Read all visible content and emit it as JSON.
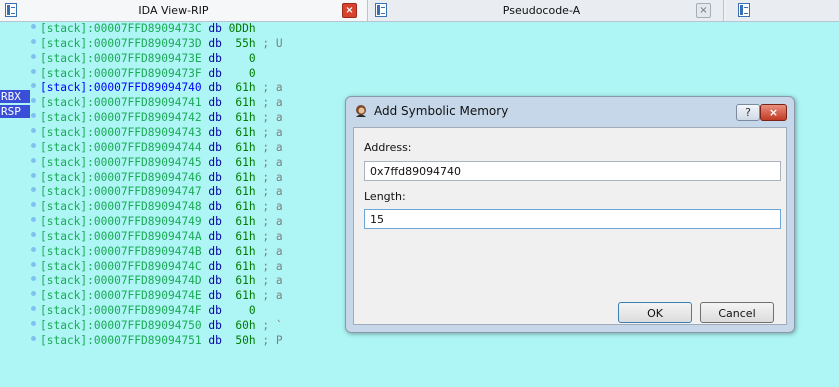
{
  "tabs": {
    "ida_view": {
      "title": "IDA View-RIP",
      "close": "×"
    },
    "pseudocode": {
      "title": "Pseudocode-A",
      "close": "×"
    }
  },
  "registers": {
    "rbx": "RBX",
    "rsp": "RSP"
  },
  "listing": [
    {
      "addr": "[stack]:00007FFD8909473C",
      "mn": "db",
      "val": "0DDh",
      "cmt": ""
    },
    {
      "addr": "[stack]:00007FFD8909473D",
      "mn": "db",
      "val": "55h",
      "cmt": "; U"
    },
    {
      "addr": "[stack]:00007FFD8909473E",
      "mn": "db",
      "val": "0",
      "cmt": ""
    },
    {
      "addr": "[stack]:00007FFD8909473F",
      "mn": "db",
      "val": "0",
      "cmt": ""
    },
    {
      "addr": "[stack]:00007FFD89094740",
      "mn": "db",
      "val": "61h",
      "cmt": "; a"
    },
    {
      "addr": "[stack]:00007FFD89094741",
      "mn": "db",
      "val": "61h",
      "cmt": "; a"
    },
    {
      "addr": "[stack]:00007FFD89094742",
      "mn": "db",
      "val": "61h",
      "cmt": "; a"
    },
    {
      "addr": "[stack]:00007FFD89094743",
      "mn": "db",
      "val": "61h",
      "cmt": "; a"
    },
    {
      "addr": "[stack]:00007FFD89094744",
      "mn": "db",
      "val": "61h",
      "cmt": "; a"
    },
    {
      "addr": "[stack]:00007FFD89094745",
      "mn": "db",
      "val": "61h",
      "cmt": "; a"
    },
    {
      "addr": "[stack]:00007FFD89094746",
      "mn": "db",
      "val": "61h",
      "cmt": "; a"
    },
    {
      "addr": "[stack]:00007FFD89094747",
      "mn": "db",
      "val": "61h",
      "cmt": "; a"
    },
    {
      "addr": "[stack]:00007FFD89094748",
      "mn": "db",
      "val": "61h",
      "cmt": "; a"
    },
    {
      "addr": "[stack]:00007FFD89094749",
      "mn": "db",
      "val": "61h",
      "cmt": "; a"
    },
    {
      "addr": "[stack]:00007FFD8909474A",
      "mn": "db",
      "val": "61h",
      "cmt": "; a"
    },
    {
      "addr": "[stack]:00007FFD8909474B",
      "mn": "db",
      "val": "61h",
      "cmt": "; a"
    },
    {
      "addr": "[stack]:00007FFD8909474C",
      "mn": "db",
      "val": "61h",
      "cmt": "; a"
    },
    {
      "addr": "[stack]:00007FFD8909474D",
      "mn": "db",
      "val": "61h",
      "cmt": "; a"
    },
    {
      "addr": "[stack]:00007FFD8909474E",
      "mn": "db",
      "val": "61h",
      "cmt": "; a"
    },
    {
      "addr": "[stack]:00007FFD8909474F",
      "mn": "db",
      "val": "0",
      "cmt": ""
    },
    {
      "addr": "[stack]:00007FFD89094750",
      "mn": "db",
      "val": "60h",
      "cmt": "; `"
    },
    {
      "addr": "[stack]:00007FFD89094751",
      "mn": "db",
      "val": "50h",
      "cmt": "; P"
    }
  ],
  "dialog": {
    "title": "Add Symbolic Memory",
    "help": "?",
    "close": "×",
    "address_label": "Address:",
    "address_value": "0x7ffd89094740",
    "length_label": "Length:",
    "length_value": "15",
    "ok_label": "OK",
    "cancel_label": "Cancel"
  },
  "colors": {
    "background": "#aef6f6",
    "address": "#1aaa55",
    "mnemonic": "#0000a0",
    "register_highlight": "#3a4fd8"
  }
}
